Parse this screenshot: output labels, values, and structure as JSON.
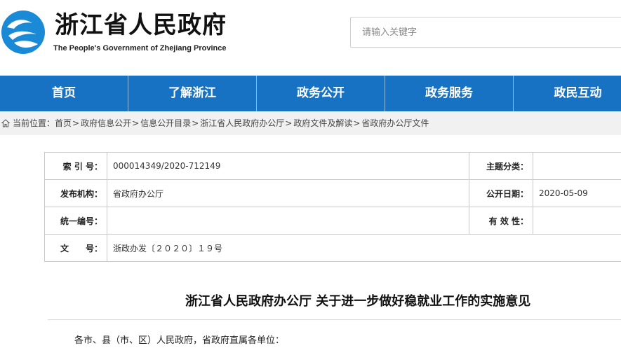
{
  "header": {
    "site_title": "浙江省人民政府",
    "site_subtitle": "The People's Government of Zhejiang Province",
    "emblem_icon": "zhejiang-wave-emblem-icon",
    "brand_color": "#1b8ad6"
  },
  "search": {
    "placeholder": "请输入关键字"
  },
  "nav": {
    "background": "#1872c4",
    "items": [
      {
        "label": "首页"
      },
      {
        "label": "了解浙江"
      },
      {
        "label": "政务公开"
      },
      {
        "label": "政务服务"
      },
      {
        "label": "政民互动"
      }
    ]
  },
  "breadcrumb": {
    "home_icon": "home-icon",
    "prefix": "当前位置：",
    "items": [
      {
        "label": "首页"
      },
      {
        "label": "政府信息公开"
      },
      {
        "label": "信息公开目录"
      },
      {
        "label": "浙江省人民政府办公厅"
      },
      {
        "label": "政府文件及解读"
      },
      {
        "label": "省政府办公厅文件"
      }
    ],
    "separator": ">"
  },
  "info": {
    "index_label": "索 引 号：",
    "index_value": "000014349/2020-712149",
    "topic_label": "主题分类：",
    "topic_value": "",
    "issuer_label": "发布机构：",
    "issuer_value": "省政府办公厅",
    "date_label": "公开日期：",
    "date_value": "2020-05-09",
    "serial_label": "统一编号：",
    "serial_value": "",
    "validity_label": "有 效 性：",
    "validity_value": "",
    "doc_label": "文　　号：",
    "doc_value": "浙政办发〔２０２０〕１９号"
  },
  "article": {
    "title": "浙江省人民政府办公厅 关于进一步做好稳就业工作的实施意见",
    "salutation": "各市、县（市、区）人民政府，省政府直属各单位："
  }
}
